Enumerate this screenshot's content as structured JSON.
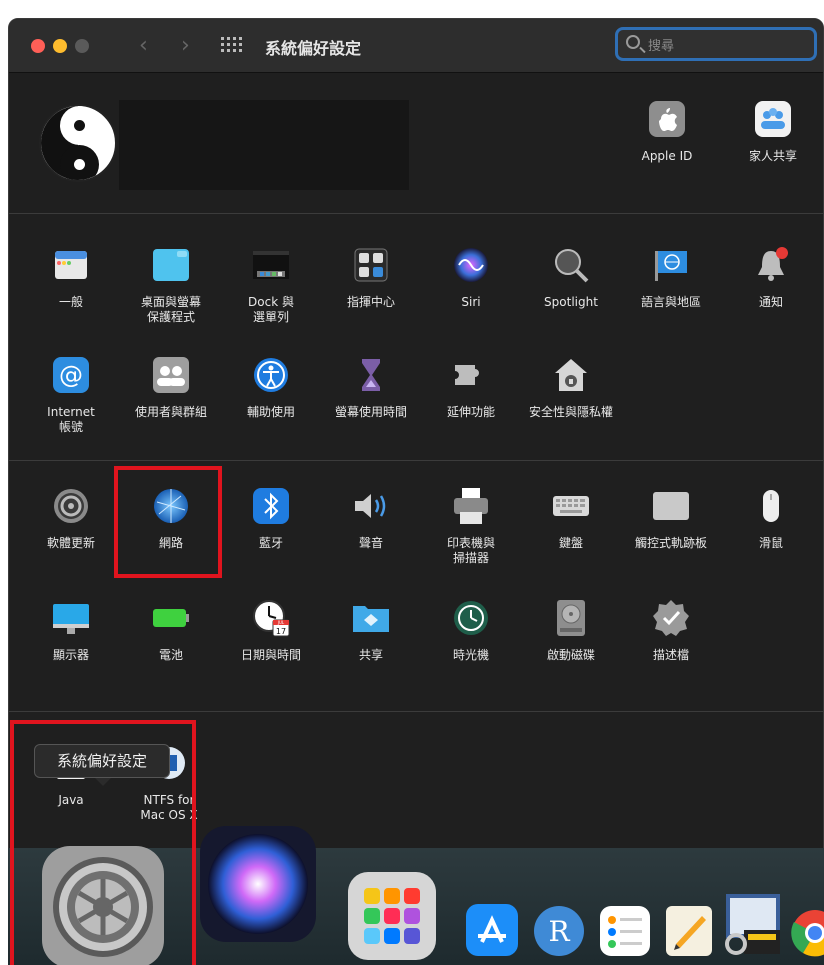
{
  "caption": "",
  "window": {
    "title": "系統偏好設定",
    "search_placeholder": "搜尋"
  },
  "account": {
    "items": [
      {
        "label": "Apple ID",
        "icon": "apple-icon"
      },
      {
        "label": "家人共享",
        "icon": "family-icon"
      }
    ]
  },
  "section1": {
    "row1": [
      "一般",
      "桌面與螢幕\n保護程式",
      "Dock 與\n選單列",
      "指揮中心",
      "Siri",
      "Spotlight",
      "語言與地區",
      "通知"
    ],
    "row2": [
      "Internet\n帳號",
      "使用者與群組",
      "輔助使用",
      "螢幕使用時間",
      "延伸功能",
      "安全性與隱私權"
    ]
  },
  "section2": {
    "row1": [
      "軟體更新",
      "網路",
      "藍牙",
      "聲音",
      "印表機與\n掃描器",
      "鍵盤",
      "觸控式軌跡板",
      "滑鼠"
    ],
    "row2": [
      "顯示器",
      "電池",
      "日期與時間",
      "共享",
      "時光機",
      "啟動磁碟",
      "描述檔"
    ],
    "calendar_day": "17",
    "calendar_month": "JUL"
  },
  "section3": {
    "items": [
      "Java",
      "NTFS for\nMac OS X"
    ]
  },
  "dock": {
    "tooltip": "系統偏好設定",
    "r_letter": "R"
  },
  "colors": {
    "highlight": "#e0141e",
    "accent_blue": "#2f6fb5"
  }
}
